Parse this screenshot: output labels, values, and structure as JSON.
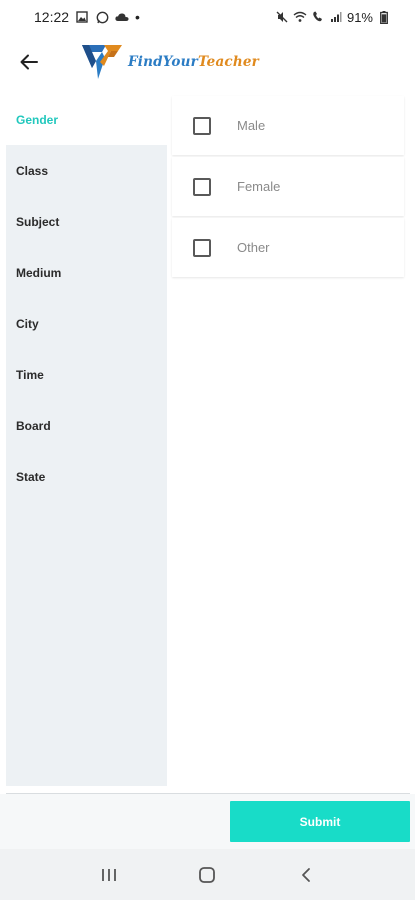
{
  "status_bar": {
    "time": "12:22",
    "dot": "•",
    "battery_percent": "91%",
    "left_icons": [
      "image-icon",
      "whatsapp-icon",
      "cloud-icon"
    ],
    "right_icons": [
      "mute-icon",
      "wifi-icon",
      "volte-icon",
      "signal-icon",
      "battery-icon"
    ]
  },
  "app_bar": {
    "logo_text_part1": "FindYour",
    "logo_text_part2": "Teacher"
  },
  "sidebar": {
    "items": [
      {
        "label": "Gender",
        "active": true
      },
      {
        "label": "Class",
        "active": false
      },
      {
        "label": "Subject",
        "active": false
      },
      {
        "label": "Medium",
        "active": false
      },
      {
        "label": "City",
        "active": false
      },
      {
        "label": "Time",
        "active": false
      },
      {
        "label": "Board",
        "active": false
      },
      {
        "label": "State",
        "active": false
      }
    ]
  },
  "options": [
    {
      "label": "Male",
      "checked": false
    },
    {
      "label": "Female",
      "checked": false
    },
    {
      "label": "Other",
      "checked": false
    }
  ],
  "footer": {
    "submit_label": "Submit"
  },
  "colors": {
    "accent": "#22c8bd",
    "submit_bg": "#18dcc8",
    "sidebar_bg": "#edf1f4",
    "logo_blue": "#2b7cc4",
    "logo_orange": "#e08a1e"
  }
}
